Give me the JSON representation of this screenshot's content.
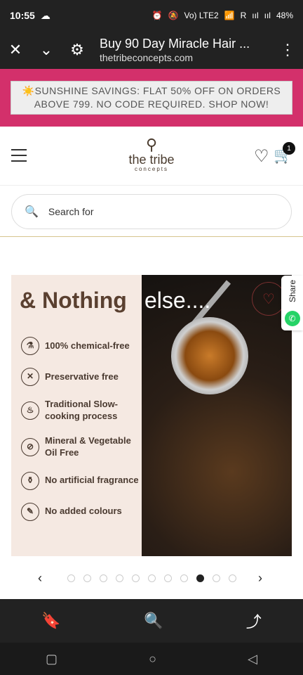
{
  "status": {
    "time": "10:55",
    "right_items": [
      "⏰",
      "🔕",
      "Vo) LTE2",
      "📶",
      "R",
      "ııl",
      "ııl",
      "48%"
    ]
  },
  "browser": {
    "title": "Buy 90 Day Miracle Hair ...",
    "url": "thetribeconcepts.com",
    "close_icon": "close-icon",
    "chevron_icon": "chevron-down-icon",
    "settings_icon": "tune-icon",
    "menu_icon": "more-vertical-icon"
  },
  "promo": {
    "text": "☀️SUNSHINE SAVINGS: FLAT 50% OFF ON ORDERS ABOVE 799. NO CODE REQUIRED. SHOP NOW!",
    "bg": "#d3306b"
  },
  "header": {
    "logo_mark": "⚲",
    "logo_name": "the tribe",
    "logo_sub": "concepts",
    "cart_count": "1"
  },
  "search": {
    "placeholder": "Search for"
  },
  "banner": {
    "heading_brown": "& Nothing",
    "heading_white": "else....",
    "features": [
      {
        "icon": "⚗",
        "text": "100% chemical-free"
      },
      {
        "icon": "✕",
        "text": "Preservative free"
      },
      {
        "icon": "♨",
        "text": "Traditional Slow-cooking process"
      },
      {
        "icon": "⊘",
        "text": "Mineral & Vegetable Oil Free"
      },
      {
        "icon": "⚱",
        "text": "No artificial fragrance"
      },
      {
        "icon": "✎",
        "text": "No added colours"
      }
    ]
  },
  "share": {
    "label": "Share"
  },
  "pager": {
    "prev": "‹",
    "next": "›",
    "total": 11,
    "active_index": 8
  },
  "bottom_bar": {
    "icons": [
      "bookmark-icon",
      "search-icon",
      "share-icon"
    ]
  },
  "system_nav": {
    "icons": [
      "recent-apps-icon",
      "home-icon",
      "back-icon"
    ]
  }
}
